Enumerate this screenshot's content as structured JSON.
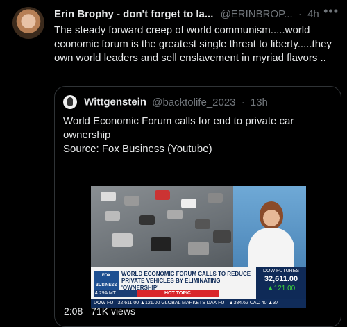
{
  "tweet": {
    "author_name": "Erin Brophy - don't forget to la...",
    "author_handle": "@ERINBROP...",
    "separator": "·",
    "time": "4h",
    "more_icon": "more-icon",
    "text": "The steady forward creep of world communism.....world economic forum is the greatest single threat to liberty.....they own world leaders and sell enslavement in myriad  flavors .."
  },
  "quote": {
    "author_name": "Wittgenstein",
    "author_handle": "@backtolife_2023",
    "separator": "·",
    "time": "13h",
    "text_line1": "World Economic Forum calls for end to private car ownership",
    "text_line2": "Source: Fox Business (Youtube)"
  },
  "video": {
    "channel_logo": "FOX BUSINESS",
    "live_label": "4:29A MT",
    "hot_topic": "HOT TOPIC",
    "headline": "WORLD ECONOMIC FORUM CALLS TO REDUCE PRIVATE VEHICLES BY ELIMINATING 'OWNERSHIP'",
    "dow_label": "DOW FUTURES",
    "dow_value": "32,611.00",
    "dow_change": "▲121.00",
    "ticker": "DOW FUT 32,611.00 ▲121.00   GLOBAL MARKETS   DAX FUT ▲384.62   CAC 40 ▲37"
  },
  "video_footer": {
    "duration": "2:08",
    "views": "71K views"
  }
}
